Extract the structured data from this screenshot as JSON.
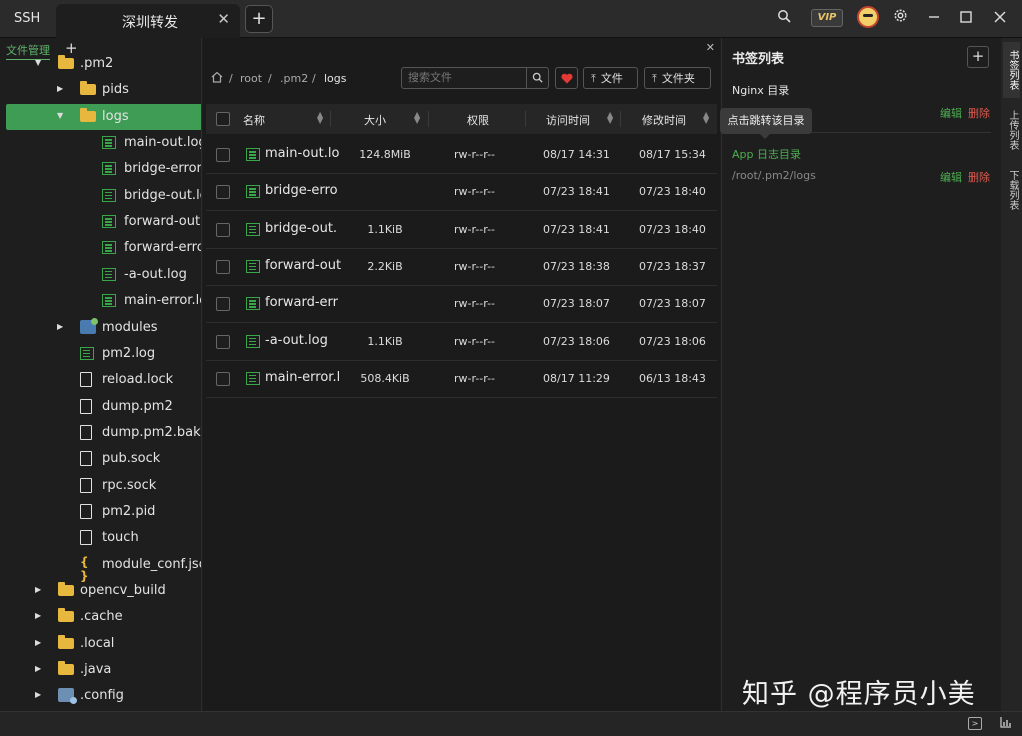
{
  "titlebar": {
    "app_name": "SSH",
    "tab_label": "深圳转发",
    "tab_close": "✕",
    "tab_add": "+",
    "vip_label": "VIP"
  },
  "file_manager": {
    "title": "文件管理",
    "add": "+",
    "tree": [
      {
        "label": ".pm2",
        "type": "folder",
        "expanded": true,
        "level": 1
      },
      {
        "label": "pids",
        "type": "folder",
        "expanded": false,
        "level": 2
      },
      {
        "label": "logs",
        "type": "folder",
        "expanded": true,
        "level": 2,
        "selected": true
      },
      {
        "label": "main-out.log",
        "type": "log",
        "level": 3
      },
      {
        "label": "bridge-error.",
        "type": "log",
        "level": 3
      },
      {
        "label": "bridge-out.lo",
        "type": "log",
        "level": 3
      },
      {
        "label": "forward-out.l",
        "type": "log",
        "level": 3
      },
      {
        "label": "forward-erro",
        "type": "log",
        "level": 3
      },
      {
        "label": "-a-out.log",
        "type": "log",
        "level": 3
      },
      {
        "label": "main-error.lo",
        "type": "log",
        "level": 3
      },
      {
        "label": "modules",
        "type": "module",
        "expanded": false,
        "level": 2
      },
      {
        "label": "pm2.log",
        "type": "log",
        "level": 2
      },
      {
        "label": "reload.lock",
        "type": "doc",
        "level": 2
      },
      {
        "label": "dump.pm2",
        "type": "doc",
        "level": 2
      },
      {
        "label": "dump.pm2.bak",
        "type": "doc",
        "level": 2
      },
      {
        "label": "pub.sock",
        "type": "doc",
        "level": 2
      },
      {
        "label": "rpc.sock",
        "type": "doc",
        "level": 2
      },
      {
        "label": "pm2.pid",
        "type": "doc",
        "level": 2
      },
      {
        "label": "touch",
        "type": "doc",
        "level": 2
      },
      {
        "label": "module_conf.jso",
        "type": "json",
        "level": 2
      },
      {
        "label": "opencv_build",
        "type": "folder",
        "expanded": false,
        "level": 1
      },
      {
        "label": ".cache",
        "type": "folder",
        "expanded": false,
        "level": 1
      },
      {
        "label": ".local",
        "type": "folder",
        "expanded": false,
        "level": 1
      },
      {
        "label": ".java",
        "type": "folder",
        "expanded": false,
        "level": 1
      },
      {
        "label": ".config",
        "type": "config",
        "expanded": false,
        "level": 1
      }
    ]
  },
  "browser": {
    "close": "✕",
    "breadcrumb": [
      "root",
      ".pm2",
      "logs"
    ],
    "breadcrumb_sep": "/",
    "search_placeholder": "搜索文件",
    "upload_label": "文件",
    "upload_folder_label": "文件夹",
    "columns": {
      "name": "名称",
      "size": "大小",
      "perm": "权限",
      "atime": "访问时间",
      "mtime": "修改时间"
    },
    "rows": [
      {
        "name": "main-out.lo",
        "size": "124.8MiB",
        "perm": "rw-r--r--",
        "atime": "08/17 14:31",
        "mtime": "08/17 15:34"
      },
      {
        "name": "bridge-erro",
        "size": "",
        "perm": "rw-r--r--",
        "atime": "07/23 18:41",
        "mtime": "07/23 18:40"
      },
      {
        "name": "bridge-out.",
        "size": "1.1KiB",
        "perm": "rw-r--r--",
        "atime": "07/23 18:41",
        "mtime": "07/23 18:40"
      },
      {
        "name": "forward-out",
        "size": "2.2KiB",
        "perm": "rw-r--r--",
        "atime": "07/23 18:38",
        "mtime": "07/23 18:37"
      },
      {
        "name": "forward-err",
        "size": "",
        "perm": "rw-r--r--",
        "atime": "07/23 18:07",
        "mtime": "07/23 18:07"
      },
      {
        "name": "-a-out.log",
        "size": "1.1KiB",
        "perm": "rw-r--r--",
        "atime": "07/23 18:06",
        "mtime": "07/23 18:06"
      },
      {
        "name": "main-error.l",
        "size": "508.4KiB",
        "perm": "rw-r--r--",
        "atime": "08/17 11:29",
        "mtime": "06/13 18:43"
      }
    ]
  },
  "bookmarks": {
    "title": "书签列表",
    "add": "+",
    "tooltip": "点击跳转该目录",
    "items": [
      {
        "name": "Nginx 目录",
        "path": "",
        "edit": "编辑",
        "delete": "删除",
        "color": "#e6e6e6"
      },
      {
        "name": "App 日志目录",
        "path": "/root/.pm2/logs",
        "edit": "编辑",
        "delete": "删除",
        "color": "#4caf50"
      }
    ]
  },
  "side_tabs": [
    "书签列表",
    "上传列表",
    "下载列表"
  ],
  "watermark": "知乎 @程序员小美",
  "colors": {
    "accent": "#3e9c54",
    "danger": "#e05a4e",
    "heart": "#e53935"
  }
}
